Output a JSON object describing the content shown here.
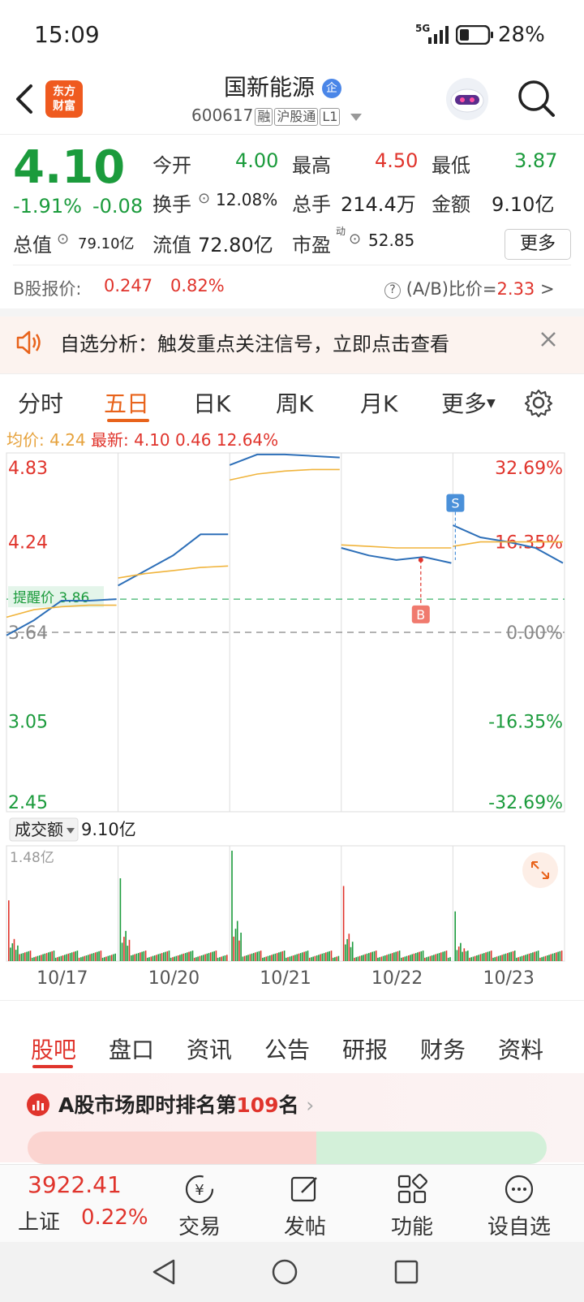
{
  "status": {
    "time": "15:09",
    "network": "5G",
    "battery": "28%"
  },
  "header": {
    "logo_line1": "东方",
    "logo_line2": "财富",
    "title": "国新能源",
    "title_badge": "企",
    "code": "600617",
    "tags": [
      "融",
      "沪股通",
      "L1"
    ]
  },
  "quote": {
    "price": "4.10",
    "change_pct": "-1.91%",
    "change": "-0.08",
    "open_label": "今开",
    "open": "4.00",
    "high_label": "最高",
    "high": "4.50",
    "low_label": "最低",
    "low": "3.87",
    "turnover_label": "换手",
    "turnover": "12.08%",
    "volume_label": "总手",
    "volume": "214.4万",
    "amount_label": "金额",
    "amount": "9.10亿",
    "mktcap_label": "总值",
    "mktcap": "79.10亿",
    "float_label": "流值",
    "float_cap": "72.80亿",
    "pe_label": "市盈",
    "pe_sup": "动",
    "pe": "52.85",
    "more": "更多",
    "b_label": "B股报价:",
    "b_price": "0.247",
    "b_pct": "0.82%",
    "ab_label": "(A/B)比价=",
    "ab_value": "2.33"
  },
  "banner": {
    "text": "自选分析：触发重点关注信号，立即点击查看"
  },
  "ktabs": [
    "分时",
    "五日",
    "日K",
    "周K",
    "月K",
    "更多"
  ],
  "chart_info": {
    "avg_label": "均价:",
    "avg": "4.24",
    "latest_label": "最新:",
    "latest": "4.10",
    "latest_chg": "0.46",
    "latest_pct": "12.64%"
  },
  "chart_data": {
    "type": "line",
    "y_ticks_left": [
      "4.83",
      "4.24",
      "3.64",
      "3.05",
      "2.45"
    ],
    "y_ticks_right": [
      "32.69%",
      "16.35%",
      "0.00%",
      "-16.35%",
      "-32.69%"
    ],
    "ylim": [
      2.45,
      4.83
    ],
    "x_labels": [
      "10/17",
      "10/20",
      "10/21",
      "10/22",
      "10/23"
    ],
    "alert_label": "提醒价 3.86",
    "alert_price": 3.86,
    "markers": [
      "S",
      "B"
    ],
    "series": [
      {
        "values": [
          3.62,
          3.72,
          3.85,
          3.85,
          3.86,
          3.95,
          4.05,
          4.15,
          4.29,
          4.29,
          4.75,
          4.82,
          4.82,
          4.81,
          4.8,
          4.2,
          4.15,
          4.12,
          4.14,
          4.1,
          4.35,
          4.27,
          4.24,
          4.2,
          4.1
        ]
      },
      {
        "values": [
          3.74,
          3.79,
          3.81,
          3.82,
          3.82,
          4.0,
          4.03,
          4.05,
          4.07,
          4.08,
          4.65,
          4.69,
          4.71,
          4.72,
          4.72,
          4.22,
          4.21,
          4.2,
          4.2,
          4.2,
          4.21,
          4.24,
          4.24,
          4.24,
          4.24
        ]
      }
    ],
    "volume_label": "成交额",
    "volume_total": "9.10亿",
    "volume_max": "1.48亿"
  },
  "btabs": [
    "股吧",
    "盘口",
    "资讯",
    "公告",
    "研报",
    "财务",
    "资料"
  ],
  "rank": {
    "text_prefix": "A股市场即时排名第",
    "rank": "109",
    "text_suffix": "名",
    "up_pct": "56%",
    "down_pct": "44%"
  },
  "bottomnav": {
    "index_value": "3922.41",
    "index_name": "上证",
    "index_pct": "0.22%",
    "items": [
      "交易",
      "发帖",
      "功能",
      "设自选"
    ]
  }
}
